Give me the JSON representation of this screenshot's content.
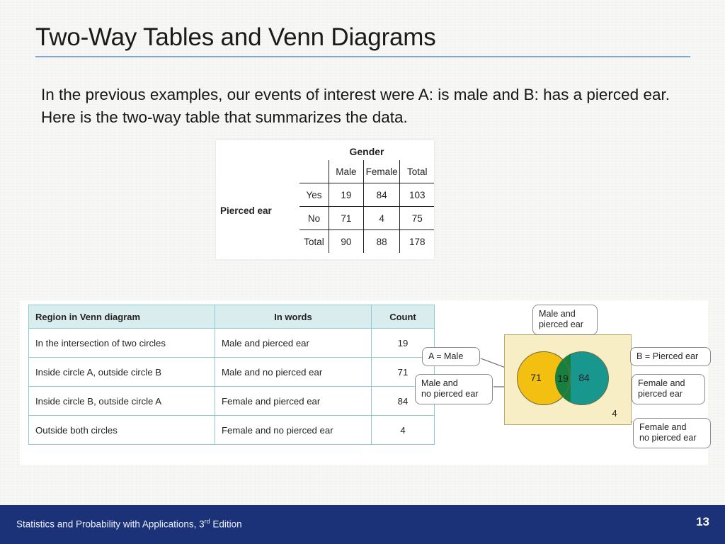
{
  "slide": {
    "title": "Two-Way Tables and Venn Diagrams",
    "body": "In the previous examples, our events of interest were A: is male and B: has a pierced ear. Here is the two-way table that summarizes the data.",
    "accent_rule_color": "#7fa5d8"
  },
  "two_way_table": {
    "column_group_label": "Gender",
    "row_group_label": "Pierced ear",
    "column_headers": [
      "Male",
      "Female",
      "Total"
    ],
    "rows": [
      {
        "label": "Yes",
        "cells": [
          "19",
          "84",
          "103"
        ]
      },
      {
        "label": "No",
        "cells": [
          "71",
          "4",
          "75"
        ]
      },
      {
        "label": "Total",
        "cells": [
          "90",
          "88",
          "178"
        ]
      }
    ]
  },
  "region_table": {
    "headers": [
      "Region in Venn diagram",
      "In words",
      "Count"
    ],
    "header_bg": "#d9edef",
    "border_color": "#8fc9cd",
    "rows": [
      {
        "region": "In the intersection of two circles",
        "words": "Male and pierced ear",
        "count": "19"
      },
      {
        "region": "Inside circle A, outside circle B",
        "words": "Male and no pierced ear",
        "count": "71"
      },
      {
        "region": "Inside circle B, outside circle A",
        "words": "Female and pierced ear",
        "count": "84"
      },
      {
        "region": "Outside both circles",
        "words": "Female and no pierced ear",
        "count": "4"
      }
    ]
  },
  "venn": {
    "universe_color": "#f7eec6",
    "circle_a_color": "#f3c011",
    "circle_b_color": "#17978e",
    "intersection_color": "#17803f",
    "counts": {
      "a_only": "71",
      "intersection": "19",
      "b_only": "84",
      "outside": "4"
    },
    "callouts": {
      "top": "Male and\npierced ear",
      "circle_a": "A = Male",
      "male_no_pierced": "Male and\nno pierced ear",
      "circle_b": "B = Pierced ear",
      "female_pierced": "Female and\npierced ear",
      "female_no_pierced": "Female and\nno pierced ear"
    }
  },
  "footer": {
    "source_prefix": "Statistics and Probability with Applications, 3",
    "source_sup": "rd",
    "source_suffix": " Edition",
    "page_number": "13",
    "bar_color": "#1b3278"
  }
}
